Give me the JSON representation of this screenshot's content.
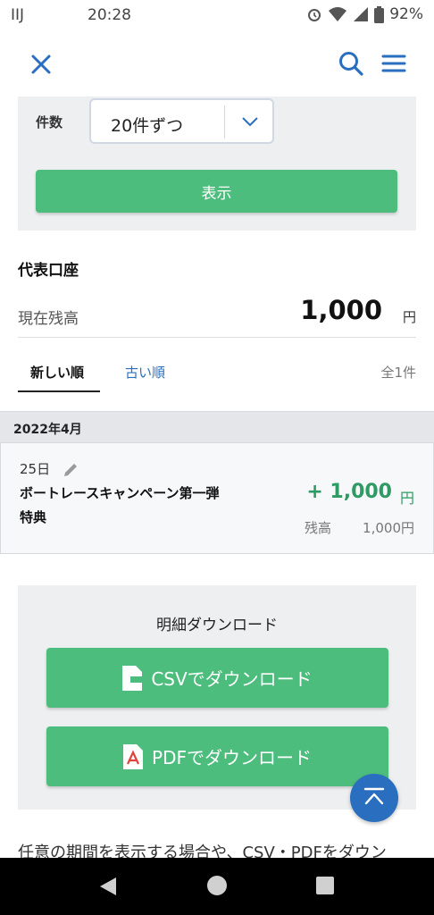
{
  "status_bar": {
    "carrier": "IIJ",
    "time": "20:28",
    "battery": "92%"
  },
  "filter": {
    "count_label": "件数",
    "count_value": "20件ずつ",
    "show_button": "表示"
  },
  "account": {
    "name": "代表口座",
    "balance_label": "現在残高",
    "balance": "1,000",
    "unit": "円"
  },
  "sort": {
    "newest": "新しい順",
    "oldest": "古い順",
    "total": "全1件"
  },
  "transactions": {
    "month": "2022年4月",
    "items": [
      {
        "date": "25日",
        "description": "ボートレースキャンペーン第一弾特典",
        "amount": "+ 1,000",
        "unit": "円",
        "balance_label": "残高",
        "balance": "1,000円"
      }
    ]
  },
  "download": {
    "title": "明細ダウンロード",
    "csv_label": "CSVでダウンロード",
    "pdf_label": "PDFでダウンロード"
  },
  "note": "任意の期間を表示する場合や、CSV・PDFをダウン",
  "colors": {
    "accent_green": "#4dbd7e",
    "accent_blue": "#2a6fbf",
    "amount_green": "#2f9a63"
  },
  "icons": [
    "close-icon",
    "search-icon",
    "menu-icon",
    "chevron-down-icon",
    "pencil-icon",
    "csv-file-icon",
    "pdf-file-icon",
    "scroll-top-icon"
  ]
}
